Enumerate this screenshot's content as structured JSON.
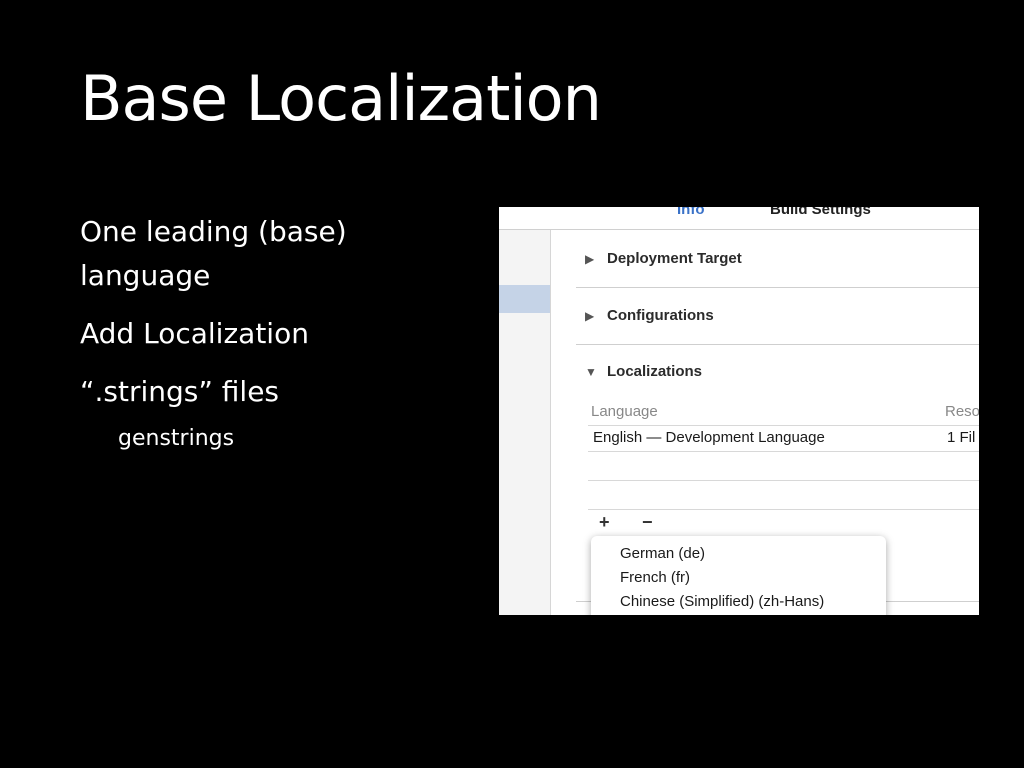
{
  "slide": {
    "title": "Base Localization",
    "bullets": [
      "One leading (base) language",
      "Add Localization",
      "“.strings” files"
    ],
    "subbullet": "genstrings"
  },
  "screenshot": {
    "tabs": {
      "info": "Info",
      "build_settings": "Build Settings"
    },
    "sections": {
      "deployment_target": "Deployment Target",
      "configurations": "Configurations",
      "localizations": "Localizations"
    },
    "table": {
      "headers": {
        "language": "Language",
        "resources": "Reso"
      },
      "row": {
        "language": "English — Development Language",
        "resources": "1 Fil"
      }
    },
    "buttons": {
      "add": "+",
      "remove": "−"
    },
    "menu_items": [
      "German (de)",
      "French (fr)",
      "Chinese (Simplified) (zh-Hans)"
    ],
    "icons": {
      "collapsed": "disclosure-right-icon",
      "expanded": "disclosure-down-icon"
    },
    "colors": {
      "selected_tab": "#3a72c8",
      "sidebar_selection": "#c5d3e7"
    }
  }
}
